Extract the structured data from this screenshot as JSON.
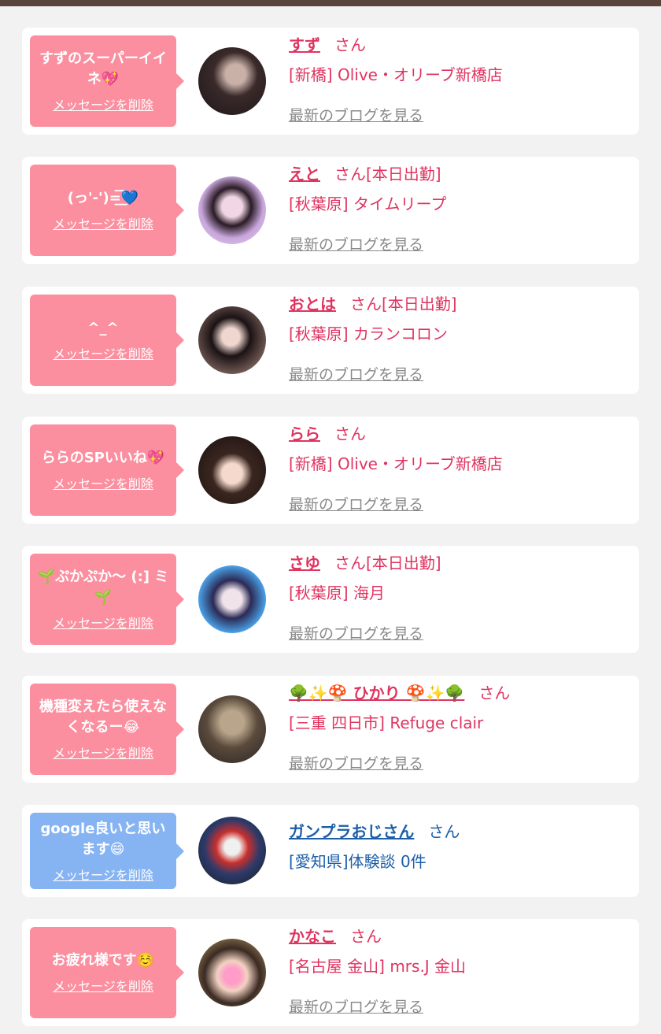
{
  "colors": {
    "top_bar": "#5b4339",
    "page_bg": "#f3f2f2",
    "pink_bubble": "#fb8f9f",
    "blue_bubble": "#86b4f3",
    "name_pink": "#e03460",
    "name_blue": "#1c5fa8"
  },
  "delete_label": "メッセージを削除",
  "blog_label": "最新のブログを見る",
  "entries": [
    {
      "message": "すずのスーパーイイネ💖",
      "bubble_color": "pink",
      "name": "すず",
      "honorific": "さん",
      "store": "[新橋] Olive・オリーブ新橋店",
      "has_blog": true,
      "avatar_icon": "avatar-photo"
    },
    {
      "message": "(っ'-')=͟͟͞͞💙",
      "bubble_color": "pink",
      "name": "えと",
      "honorific": "さん[本日出勤]",
      "store": "[秋葉原] タイムリープ",
      "has_blog": true,
      "avatar_icon": "avatar-photo"
    },
    {
      "message": "^_^",
      "bubble_color": "pink",
      "name": "おとは",
      "honorific": "さん[本日出勤]",
      "store": "[秋葉原] カランコロン",
      "has_blog": true,
      "avatar_icon": "avatar-photo"
    },
    {
      "message": "ららのSPいいね💖",
      "bubble_color": "pink",
      "name": "らら",
      "honorific": "さん",
      "store": "[新橋] Olive・オリーブ新橋店",
      "has_blog": true,
      "avatar_icon": "avatar-photo"
    },
    {
      "message": "🌱ぷかぷか〜 (:] ミ🌱",
      "bubble_color": "pink",
      "name": "さゆ",
      "honorific": "さん[本日出勤]",
      "store": "[秋葉原] 海月",
      "has_blog": true,
      "avatar_icon": "avatar-photo"
    },
    {
      "message": "機種変えたら使えなくなるー😂",
      "bubble_color": "pink",
      "name": "🌳✨🍄 ひかり 🍄✨🌳",
      "honorific": "さん",
      "store": "[三重 四日市] Refuge clair",
      "has_blog": true,
      "avatar_icon": "avatar-photo"
    },
    {
      "message": "google良いと思います😄",
      "bubble_color": "blue",
      "name": "ガンプラおじさん",
      "honorific": "さん",
      "store": "[愛知県]体験談 0件",
      "has_blog": false,
      "avatar_icon": "avatar-photo"
    },
    {
      "message": "お疲れ様です☺️",
      "bubble_color": "pink",
      "name": "かなこ",
      "honorific": "さん",
      "store": "[名古屋 金山] mrs.J 金山",
      "has_blog": true,
      "avatar_icon": "avatar-photo"
    }
  ]
}
